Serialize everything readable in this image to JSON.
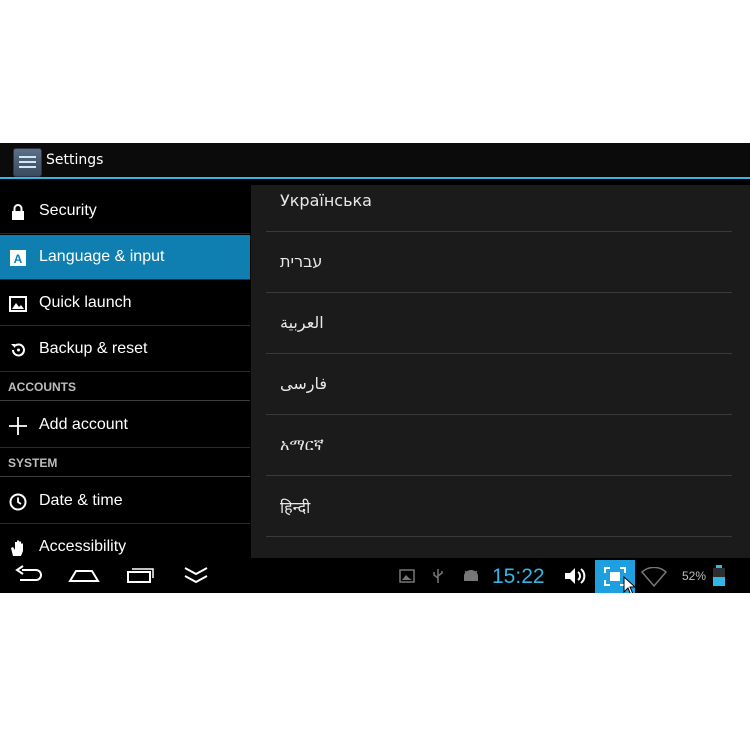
{
  "app": {
    "title": "Settings",
    "icon": "settings-icon"
  },
  "sidebar": {
    "items": [
      {
        "label": "Security",
        "icon": "lock-icon"
      },
      {
        "label": "Language & input",
        "icon": "language-icon",
        "selected": true
      },
      {
        "label": "Quick launch",
        "icon": "image-icon"
      },
      {
        "label": "Backup & reset",
        "icon": "backup-icon"
      }
    ],
    "accounts_header": "ACCOUNTS",
    "add_account": {
      "label": "Add account",
      "icon": "plus-icon"
    },
    "system_header": "SYSTEM",
    "system_items": [
      {
        "label": "Date & time",
        "icon": "clock-icon"
      },
      {
        "label": "Accessibility",
        "icon": "hand-icon"
      }
    ]
  },
  "languages": [
    "Українська",
    "עברית",
    "العربية",
    "فارسی",
    "አማርኛ",
    "हिन्दी"
  ],
  "statusbar": {
    "time": "15:22",
    "battery": "52%",
    "accent": "#33b5e5"
  }
}
